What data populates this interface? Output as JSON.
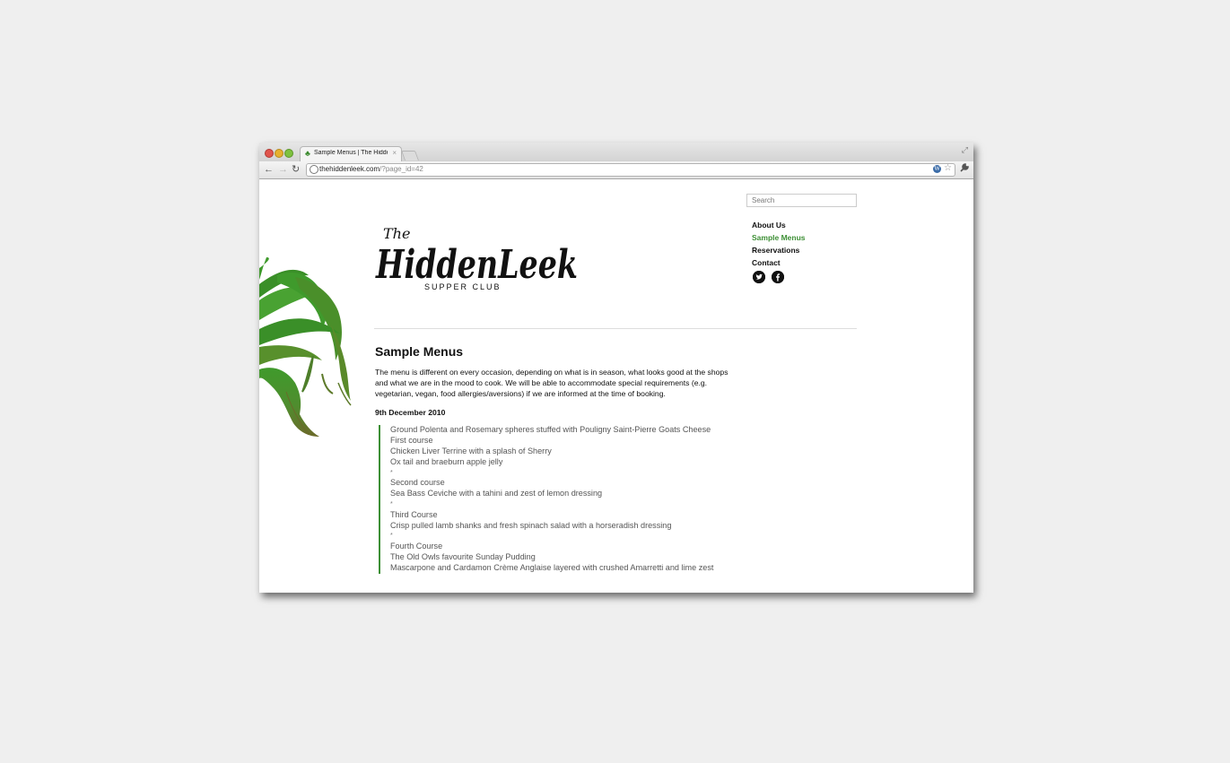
{
  "browser": {
    "tab_title": "Sample Menus | The Hidden Leek",
    "tab_close": "×",
    "url_host": "thehiddenleek.com",
    "url_path": "/?page_id=42",
    "back": "←",
    "forward": "→",
    "reload": "↻",
    "star": "☆",
    "wrench": "🔧",
    "expand": "⤢",
    "wp_badge": "W"
  },
  "logo": {
    "the": "The",
    "name": "HiddenLeek",
    "sub": "SUPPER CLUB"
  },
  "search": {
    "placeholder": "Search"
  },
  "nav": [
    {
      "label": "About Us"
    },
    {
      "label": "Sample Menus",
      "active": true
    },
    {
      "label": "Reservations"
    },
    {
      "label": "Contact"
    }
  ],
  "social": {
    "twitter": "t",
    "facebook": "f"
  },
  "content": {
    "title": "Sample Menus",
    "intro": "The menu is different on every occasion, depending on what is in season, what looks good at the shops and what we are in the mood to cook. We will be able to accommodate special requirements (e.g. vegetarian, vegan, food allergies/aversions) if we are informed at the time of booking.",
    "date": "9th December 2010",
    "menu_lines": [
      "Ground Polenta and Rosemary spheres stuffed with Pouligny Saint-Pierre Goats Cheese",
      "First course",
      "Chicken Liver Terrine with a splash of Sherry",
      "Ox tail and braeburn apple jelly",
      "*",
      "Second course",
      "Sea Bass Ceviche with a tahini  and zest of lemon dressing",
      "*",
      "Third Course",
      "Crisp pulled lamb shanks and fresh spinach salad with a horseradish dressing",
      "*",
      "Fourth Course",
      "The Old Owls favourite Sunday Pudding",
      "Mascarpone and Cardamon Crème Anglaise layered with crushed Amarretti and lime zest"
    ]
  },
  "colors": {
    "accent": "#3d8f35",
    "leek_green": "#3f9a2c",
    "leek_olive": "#6b6a2a"
  },
  "icons": {
    "leek": "leek-illustration-icon",
    "twitter": "twitter-icon",
    "facebook": "facebook-icon"
  }
}
